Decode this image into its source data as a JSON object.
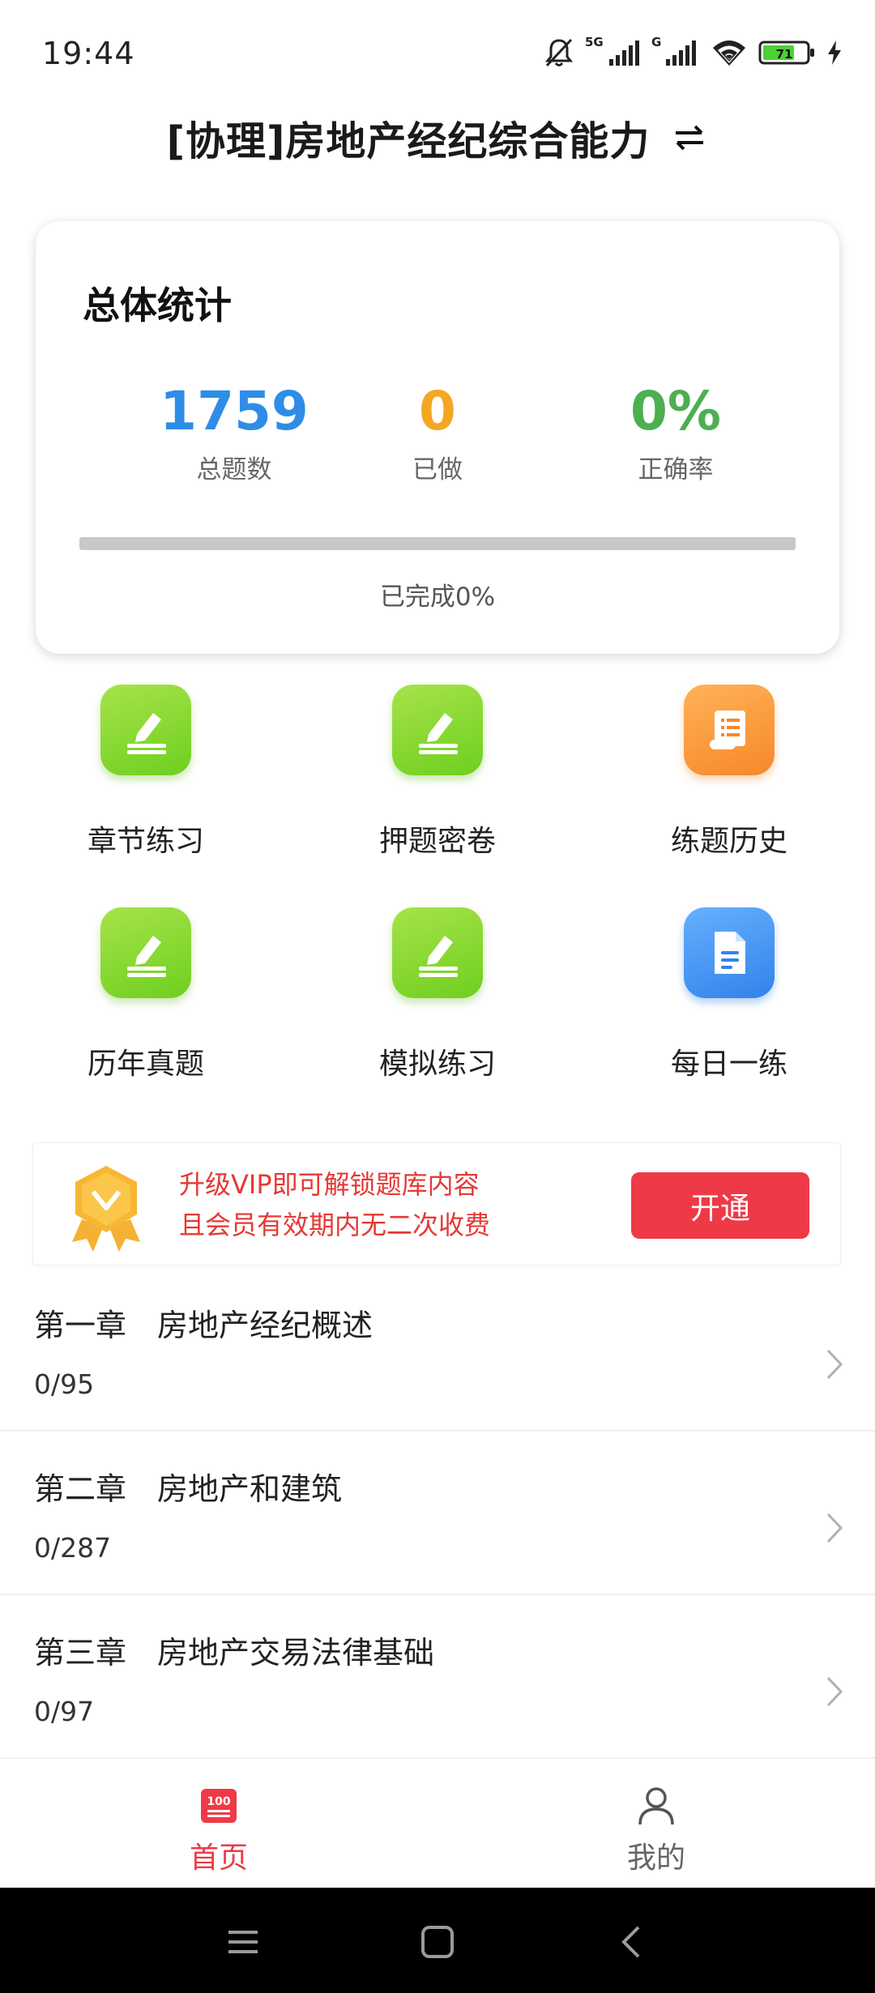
{
  "status_bar": {
    "time": "19:44",
    "network_1": "5G",
    "network_2": "G",
    "battery": "71"
  },
  "header": {
    "title": "[协理]房地产经纪综合能力"
  },
  "stats": {
    "title": "总体统计",
    "total_value": "1759",
    "total_label": "总题数",
    "done_value": "0",
    "done_label": "已做",
    "rate_value": "0%",
    "rate_label": "正确率",
    "progress_percent": 0,
    "progress_text": "已完成0%"
  },
  "grid": [
    {
      "label": "章节练习",
      "icon": "pencil-icon"
    },
    {
      "label": "押题密卷",
      "icon": "pencil-icon"
    },
    {
      "label": "练题历史",
      "icon": "scroll-icon"
    },
    {
      "label": "历年真题",
      "icon": "pencil-icon"
    },
    {
      "label": "模拟练习",
      "icon": "pencil-icon"
    },
    {
      "label": "每日一练",
      "icon": "document-icon"
    }
  ],
  "vip": {
    "line1": "升级VIP即可解锁题库内容",
    "line2": "且会员有效期内无二次收费",
    "button": "开通"
  },
  "chapters": [
    {
      "title": "第一章　房地产经纪概述",
      "progress": "0/95"
    },
    {
      "title": "第二章　房地产和建筑",
      "progress": "0/287"
    },
    {
      "title": "第三章　房地产交易法律基础",
      "progress": "0/97"
    }
  ],
  "bottom_nav": {
    "home_label": "首页",
    "home_badge": "100",
    "mine_label": "我的"
  },
  "colors": {
    "accent_red": "#ee3a47",
    "total_blue": "#2e8de6",
    "done_orange": "#f5a623",
    "rate_green": "#4caf50"
  }
}
